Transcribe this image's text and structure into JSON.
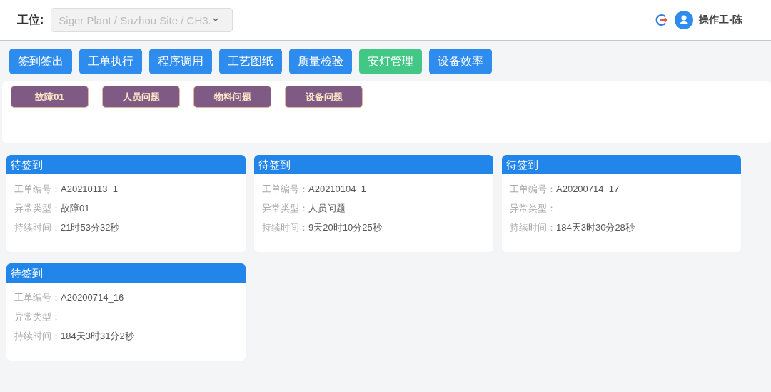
{
  "header": {
    "station_label": "工位:",
    "station_select": {
      "value": "Siger Plant / Suzhou Site / CH3."
    },
    "user": "操作工-陈"
  },
  "nav": [
    {
      "label": "签到签出",
      "selected": false
    },
    {
      "label": "工单执行",
      "selected": false
    },
    {
      "label": "程序调用",
      "selected": false
    },
    {
      "label": "工艺图纸",
      "selected": false
    },
    {
      "label": "质量检验",
      "selected": false
    },
    {
      "label": "安灯管理",
      "selected": true
    },
    {
      "label": "设备效率",
      "selected": false
    }
  ],
  "categories": [
    "故障01",
    "人员问题",
    "物料问题",
    "设备问题"
  ],
  "cards": [
    {
      "title": "待签到",
      "fields": [
        {
          "label": "工单编号：",
          "value": "A20210113_1"
        },
        {
          "label": "异常类型：",
          "value": "故障01"
        },
        {
          "label": "持续时间：",
          "value": "21时53分32秒"
        }
      ]
    },
    {
      "title": "待签到",
      "fields": [
        {
          "label": "工单编号：",
          "value": "A20210104_1"
        },
        {
          "label": "异常类型：",
          "value": "人员问题"
        },
        {
          "label": "持续时间：",
          "value": "9天20时10分25秒"
        }
      ]
    },
    {
      "title": "待签到",
      "fields": [
        {
          "label": "工单编号：",
          "value": "A20200714_17"
        },
        {
          "label": "异常类型："
        },
        {
          "label": "持续时间：",
          "value": "184天3时30分28秒"
        }
      ]
    },
    {
      "title": "待签到",
      "fields": [
        {
          "label": "工单编号：",
          "value": "A20200714_16"
        },
        {
          "label": "异常类型："
        },
        {
          "label": "持续时间：",
          "value": "184天3时31分2秒"
        }
      ]
    }
  ]
}
